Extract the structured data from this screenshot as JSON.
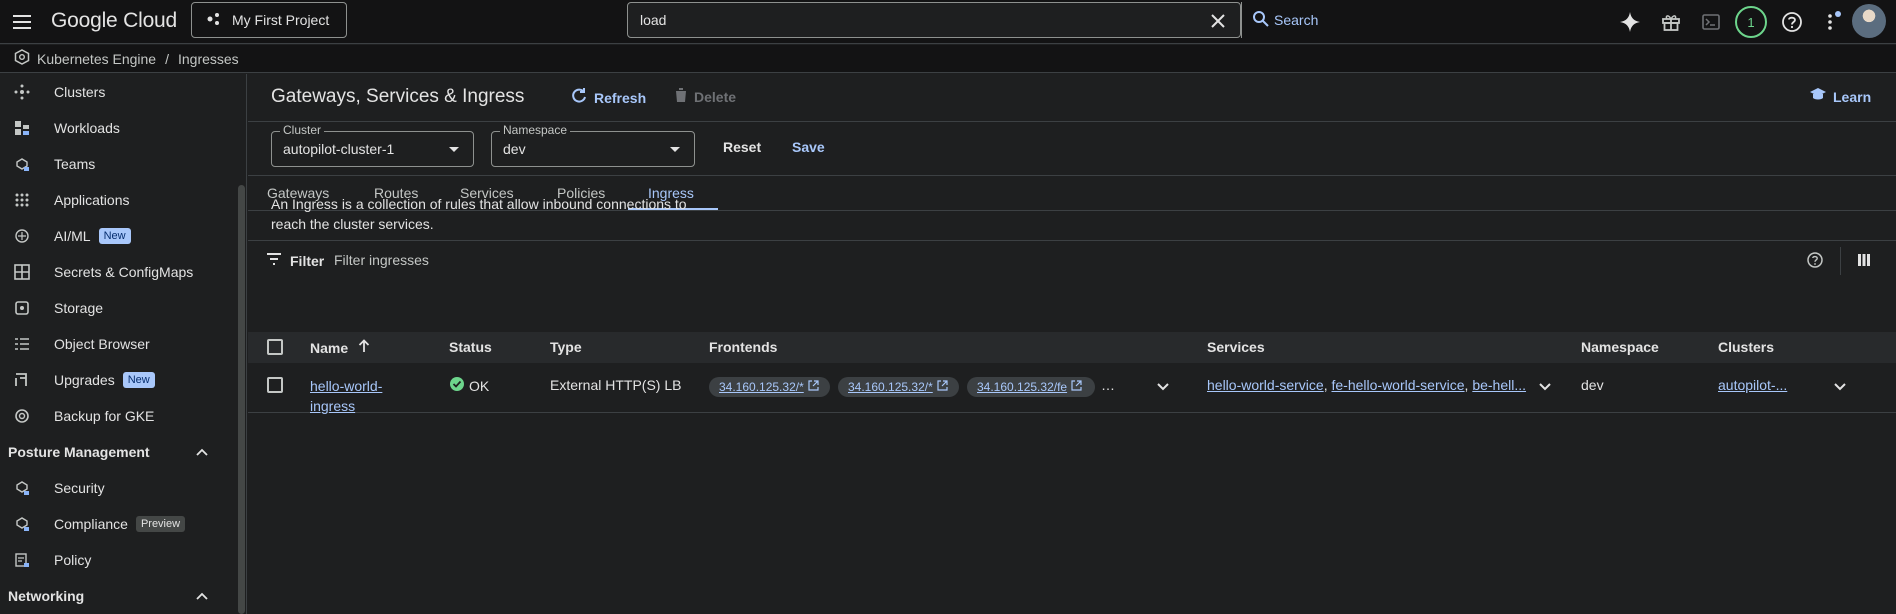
{
  "topbar": {
    "logo": "Google Cloud",
    "project": "My First Project",
    "search_value": "load",
    "search_button": "Search",
    "notification_count": "1"
  },
  "breadcrumb": {
    "product": "Kubernetes Engine",
    "separator": "/",
    "page": "Ingresses"
  },
  "sidebar": {
    "items": [
      {
        "label": "Clusters",
        "icon": "clusters-icon"
      },
      {
        "label": "Workloads",
        "icon": "workloads-icon"
      },
      {
        "label": "Teams",
        "icon": "teams-icon"
      },
      {
        "label": "Applications",
        "icon": "applications-icon"
      },
      {
        "label": "AI/ML",
        "icon": "ai-ml-icon",
        "badge": "New"
      },
      {
        "label": "Secrets & ConfigMaps",
        "icon": "secrets-icon"
      },
      {
        "label": "Storage",
        "icon": "storage-icon"
      },
      {
        "label": "Object Browser",
        "icon": "object-browser-icon"
      },
      {
        "label": "Upgrades",
        "icon": "upgrades-icon",
        "badge": "New"
      },
      {
        "label": "Backup for GKE",
        "icon": "backup-icon"
      }
    ],
    "posture_section": "Posture Management",
    "posture_items": [
      {
        "label": "Security",
        "icon": "security-icon"
      },
      {
        "label": "Compliance",
        "icon": "compliance-icon",
        "badge": "Preview"
      },
      {
        "label": "Policy",
        "icon": "policy-icon"
      }
    ],
    "networking_section": "Networking"
  },
  "main": {
    "title": "Gateways, Services & Ingress",
    "refresh": "Refresh",
    "delete": "Delete",
    "learn": "Learn",
    "cluster_label": "Cluster",
    "cluster_value": "autopilot-cluster-1",
    "namespace_label": "Namespace",
    "namespace_value": "dev",
    "reset": "Reset",
    "save": "Save",
    "tabs": [
      "Gateways",
      "Routes",
      "Services",
      "Policies",
      "Ingress"
    ],
    "active_tab": "Ingress",
    "description": "An Ingress is a collection of rules that allow inbound connections to reach the cluster services.",
    "filter_label": "Filter",
    "filter_placeholder": "Filter ingresses"
  },
  "table": {
    "headers": {
      "name": "Name",
      "status": "Status",
      "type": "Type",
      "frontends": "Frontends",
      "services": "Services",
      "namespace": "Namespace",
      "clusters": "Clusters"
    },
    "rows": [
      {
        "name_line1": "hello-world-",
        "name_line2": "ingress",
        "status": "OK",
        "type": "External HTTP(S) LB",
        "frontends": [
          "34.160.125.32/*",
          "34.160.125.32/*",
          "34.160.125.32/fe"
        ],
        "frontends_more": "…",
        "services": [
          "hello-world-service",
          "fe-hello-world-service",
          "be-hell..."
        ],
        "services_sep": ",",
        "namespace": "dev",
        "clusters": "autopilot-..."
      }
    ]
  },
  "colors": {
    "accent": "#a8c7fa",
    "ok": "#6dd58c",
    "background": "#1e1f20",
    "topbar": "#131314"
  }
}
